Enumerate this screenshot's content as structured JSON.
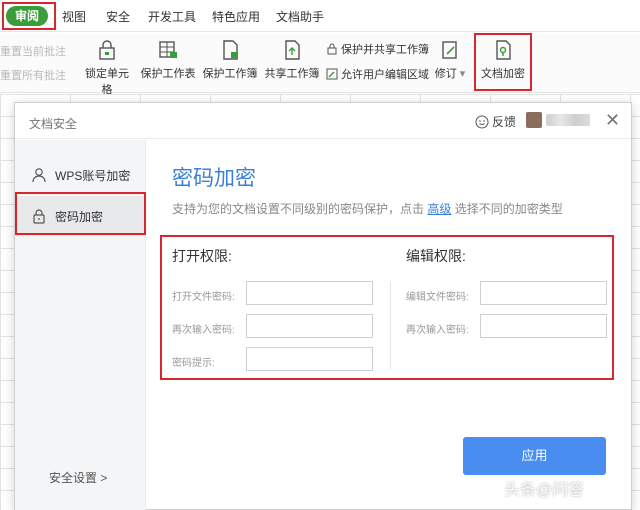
{
  "menubar": {
    "active_tab": "审阅",
    "tabs": [
      "视图",
      "安全",
      "开发工具",
      "特色应用",
      "文档助手"
    ]
  },
  "ribbon": {
    "faded": [
      "重置当前批注",
      "重置所有批注"
    ],
    "tools": [
      "锁定单元格",
      "保护工作表",
      "保护工作簿",
      "共享工作簿"
    ],
    "small_tools": [
      "保护并共享工作簿",
      "允许用户编辑区域"
    ],
    "revise": "修订",
    "encrypt": "文档加密"
  },
  "dialog": {
    "title": "文档安全",
    "feedback": "反馈",
    "close_icon": "close-icon"
  },
  "sidebar": {
    "items": [
      {
        "label": "WPS账号加密",
        "icon": "user-icon"
      },
      {
        "label": "密码加密",
        "icon": "lock-icon"
      }
    ],
    "footer": "安全设置 >"
  },
  "main": {
    "title": "密码加密",
    "desc_before": "支持为您的文档设置不同级别的密码保护，点击",
    "desc_link": "高级",
    "desc_after": "选择不同的加密类型",
    "open_section": {
      "title": "打开权限:",
      "password_label": "打开文件密码:",
      "confirm_label": "再次输入密码:",
      "hint_label": "密码提示:",
      "password_value": "",
      "confirm_value": "",
      "hint_value": ""
    },
    "edit_section": {
      "title": "编辑权限:",
      "password_label": "编辑文件密码:",
      "confirm_label": "再次输入密码:",
      "password_value": "",
      "confirm_value": ""
    },
    "apply_label": "应用"
  },
  "watermark": "头条@问答",
  "colors": {
    "accent": "#3b7fd6",
    "button": "#4a8df0",
    "highlight": "#d8262e",
    "active_tab": "#3a9d3a"
  }
}
